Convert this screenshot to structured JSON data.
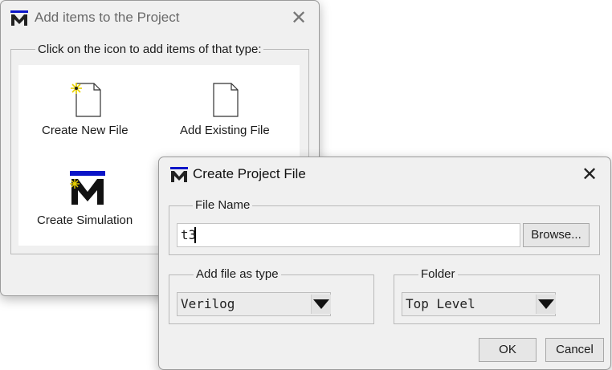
{
  "add_items_window": {
    "title": "Add items to the Project",
    "group_label": "Click on the icon to add items of that type:",
    "items": [
      {
        "label": "Create New File",
        "icon": "new-file-icon"
      },
      {
        "label": "Add Existing File",
        "icon": "existing-file-icon"
      },
      {
        "label": "Create Simulation",
        "icon": "simulation-icon"
      }
    ]
  },
  "create_file_dialog": {
    "title": "Create Project File",
    "file_name_label": "File Name",
    "file_name_value": "t3",
    "browse_label": "Browse...",
    "type_label": "Add file as type",
    "type_value": "Verilog",
    "folder_label": "Folder",
    "folder_value": "Top Level",
    "ok_label": "OK",
    "cancel_label": "Cancel"
  },
  "colors": {
    "logo_blue": "#0a14c8",
    "logo_black": "#111111",
    "spark_yellow": "#e8d000"
  }
}
